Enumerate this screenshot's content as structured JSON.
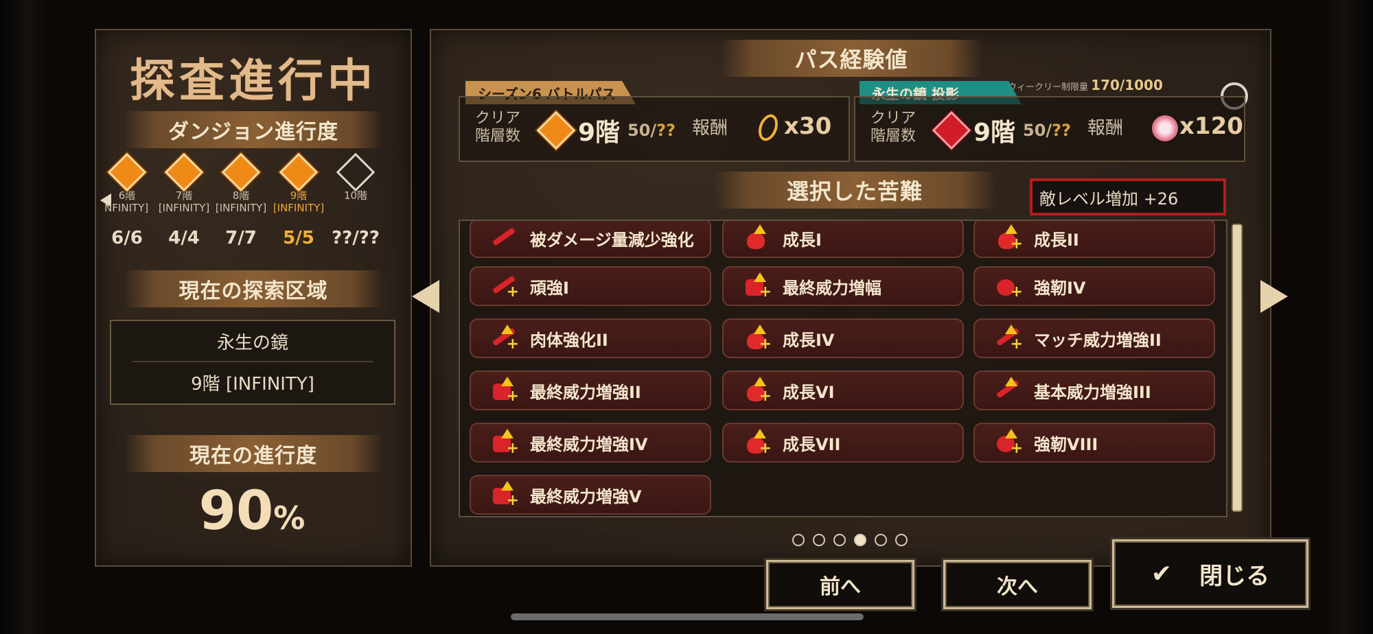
{
  "left": {
    "title": "探査進行中",
    "progress_banner": "ダンジョン進行度",
    "floors": [
      {
        "label": "6階",
        "tag": "[INFINITY]",
        "count": "6/6",
        "state": "cleared"
      },
      {
        "label": "7階",
        "tag": "[INFINITY]",
        "count": "4/4",
        "state": "cleared"
      },
      {
        "label": "8階",
        "tag": "[INFINITY]",
        "count": "7/7",
        "state": "cleared"
      },
      {
        "label": "9階",
        "tag": "[INFINITY]",
        "count": "5/5",
        "state": "current"
      },
      {
        "label": "10階",
        "tag": "",
        "count": "??/??",
        "state": "locked"
      }
    ],
    "area_banner": "現在の探索区域",
    "area_name": "永生の鏡",
    "area_floor": "9階 [INFINITY]",
    "current_banner": "現在の進行度",
    "current_value": "90",
    "current_unit": "%"
  },
  "main": {
    "exp_banner": "パス経験値",
    "weekly_label": "ウィークリー制限量",
    "weekly_value": "170/1000",
    "battle_pass": {
      "tag": "シーズン6 バトルパス",
      "clear_label_1": "クリア",
      "clear_label_2": "階層数",
      "floor": "9階",
      "sub_current": "50/",
      "sub_max": "??",
      "reward_label": "報酬",
      "reward_amount": "x30"
    },
    "mirror": {
      "tag": "永生の鏡 投影",
      "clear_label_1": "クリア",
      "clear_label_2": "階層数",
      "floor": "9階",
      "sub_current": "50/",
      "sub_max": "??",
      "reward_label": "報酬",
      "reward_amount": "x120"
    },
    "hardship_banner": "選択した苦難",
    "enemy_level": "敵レベル増加 +26",
    "hardships": [
      {
        "label": "被ダメージ量減少強化",
        "icon": "shield-down-icon"
      },
      {
        "label": "成長I",
        "icon": "heart-up-icon"
      },
      {
        "label": "成長II",
        "icon": "heart-up-plus-icon"
      },
      {
        "label": "頑強I",
        "icon": "sword-plus-icon"
      },
      {
        "label": "最終威力増幅",
        "icon": "power-up-icon"
      },
      {
        "label": "強靭IV",
        "icon": "toughness-icon"
      },
      {
        "label": "肉体強化II",
        "icon": "body-up-icon"
      },
      {
        "label": "成長IV",
        "icon": "heart-up-plus-icon"
      },
      {
        "label": "マッチ威力増強II",
        "icon": "match-power-icon"
      },
      {
        "label": "最終威力増強II",
        "icon": "power-up-icon"
      },
      {
        "label": "成長VI",
        "icon": "heart-up-plus-icon"
      },
      {
        "label": "基本威力増強III",
        "icon": "base-power-icon"
      },
      {
        "label": "最終威力増強IV",
        "icon": "power-up-icon"
      },
      {
        "label": "成長VII",
        "icon": "heart-up-plus-icon"
      },
      {
        "label": "強靭VIII",
        "icon": "toughness-icon"
      },
      {
        "label": "最終威力増強V",
        "icon": "power-up-icon"
      }
    ],
    "pager": {
      "total": 6,
      "current": 4
    }
  },
  "buttons": {
    "prev": "前へ",
    "next": "次へ",
    "close": "閉じる"
  },
  "colors": {
    "accent": "#f0b136",
    "danger": "#b51c1c",
    "teal": "#1f8f86",
    "gold_tag": "#c9924e"
  }
}
